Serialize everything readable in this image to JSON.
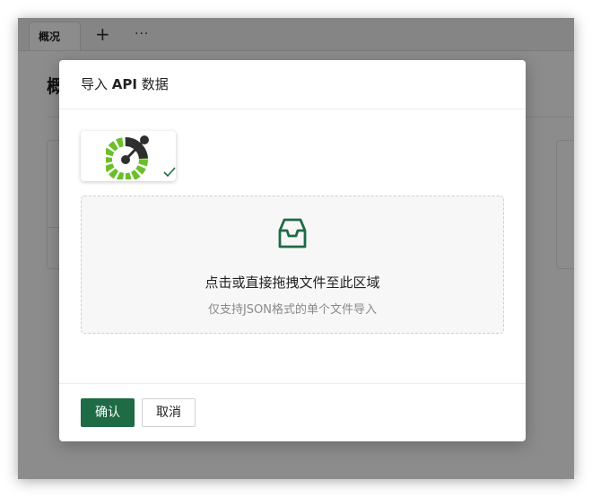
{
  "tabbar": {
    "tab_label": "概况",
    "plus_icon": "+",
    "more_icon": "···"
  },
  "page": {
    "title_partial": "概"
  },
  "modal": {
    "title_prefix": "导入 ",
    "title_api": "API",
    "title_suffix": " 数据",
    "logo": {
      "name": "openapi-logo",
      "selected": true,
      "accent": "#6bbf2a"
    },
    "dropzone": {
      "icon": "inbox-icon",
      "title": "点击或直接拖拽文件至此区域",
      "hint": "仅支持JSON格式的单个文件导入"
    },
    "footer": {
      "ok_label": "确认",
      "cancel_label": "取消"
    }
  },
  "colors": {
    "primary": "#1e6b45",
    "overlay": "rgba(0,0,0,0.45)"
  }
}
